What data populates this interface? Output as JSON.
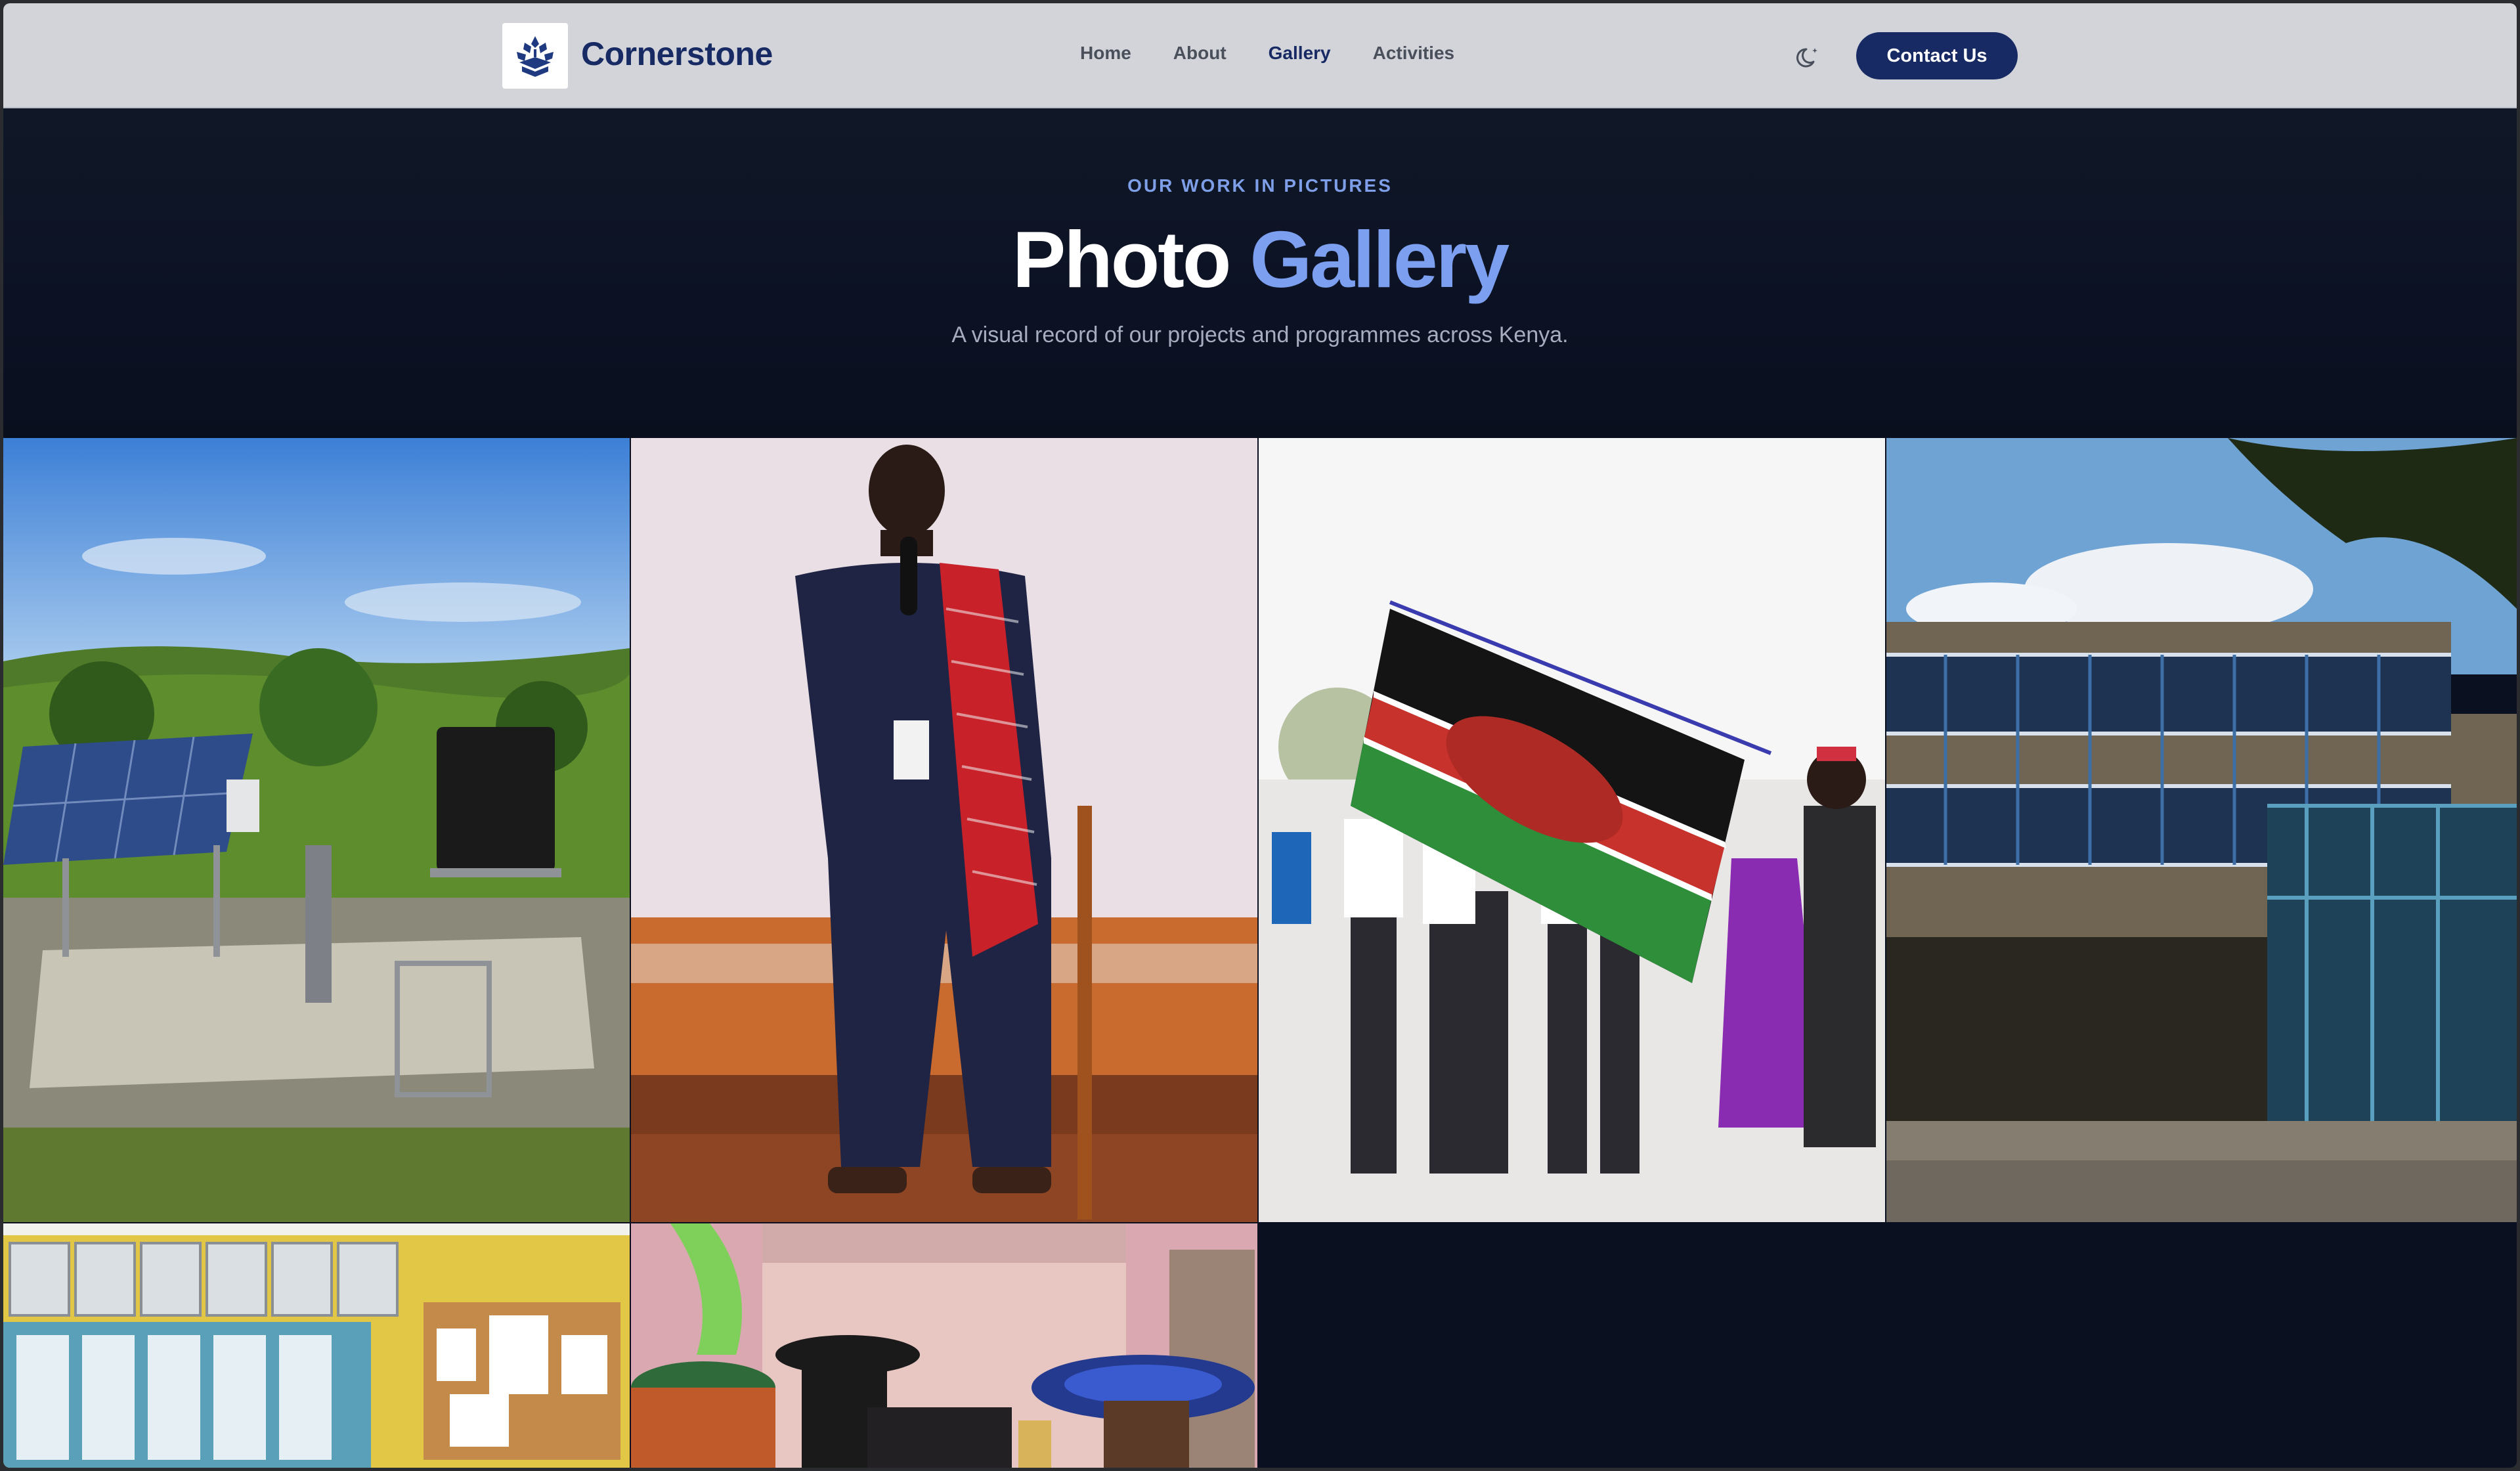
{
  "header": {
    "brand": "Cornerstone",
    "nav": [
      "Home",
      "About",
      "Gallery",
      "Activities"
    ],
    "active_nav": "Gallery",
    "theme_toggle_icon": "moon-icon",
    "contact_label": "Contact Us"
  },
  "hero": {
    "eyebrow": "OUR WORK IN PICTURES",
    "title_main": "Photo",
    "title_accent": "Gallery",
    "subtitle": "A visual record of our projects and programmes across Kenya."
  },
  "gallery": {
    "photos": [
      {
        "subject": "solar-powered-water-pump"
      },
      {
        "subject": "speaker-with-microphone-and-shuka"
      },
      {
        "subject": "kenyan-flag-ceremony"
      },
      {
        "subject": "school-building-courtyard"
      },
      {
        "subject": "classroom-interior"
      },
      {
        "subject": "graduation-ceremony"
      }
    ]
  },
  "colors": {
    "brand_navy": "#172a63",
    "accent_blue": "#7c9ff0",
    "page_dark": "#0b1020",
    "navbar_bg": "#d2d4d9"
  }
}
